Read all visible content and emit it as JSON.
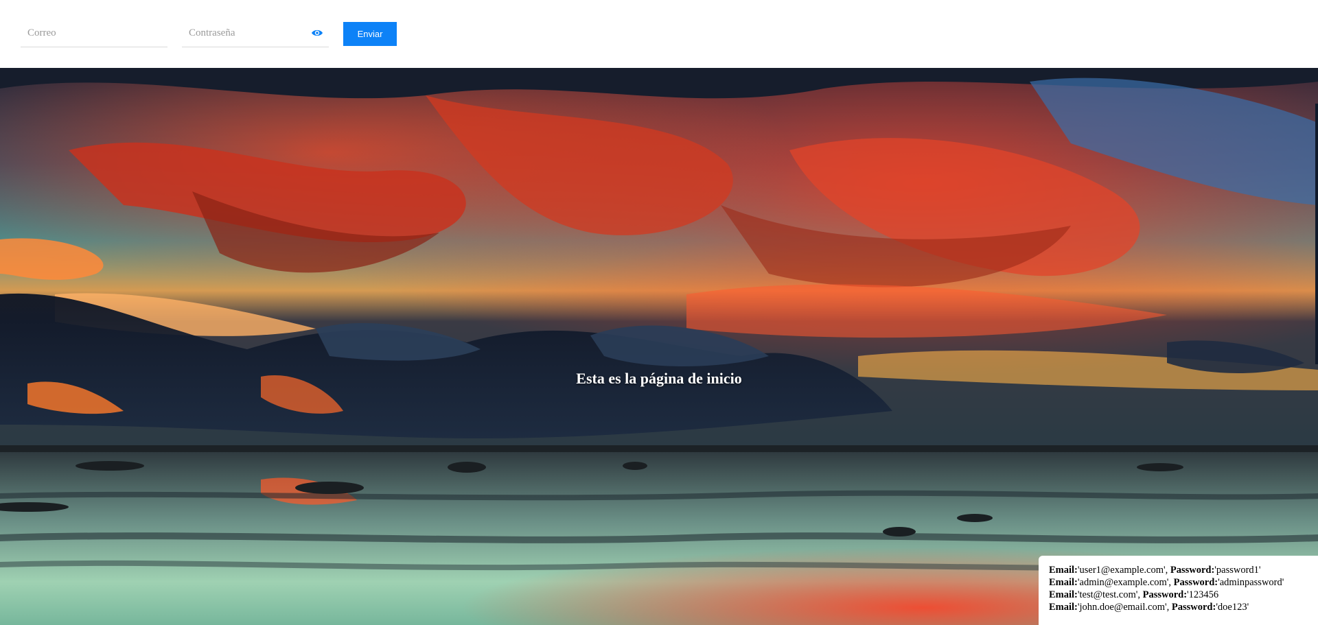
{
  "login": {
    "email_placeholder": "Correo",
    "password_placeholder": "Contraseña",
    "show_password_icon": "eye-icon",
    "submit_label": "Enviar",
    "accent_color": "#0d82f7"
  },
  "hero": {
    "title": "Esta es la página de inicio",
    "background": "sunset sky with red clouds over reflective shoreline"
  },
  "credentials": {
    "email_label": "Email:",
    "password_label": "Password:",
    "items": [
      {
        "email": "'user1@example.com',",
        "password": "'password1'"
      },
      {
        "email": "'admin@example.com',",
        "password": "'adminpassword'"
      },
      {
        "email": "'test@test.com',",
        "password": "'123456"
      },
      {
        "email": "'john.doe@email.com',",
        "password": "'doe123'"
      }
    ]
  }
}
